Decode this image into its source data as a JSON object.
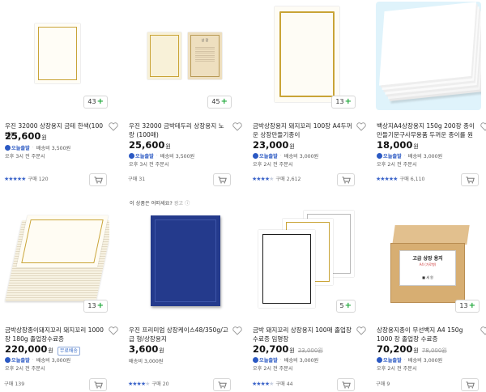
{
  "ad_notice": {
    "prefix": "이 상품은 어떠세요?",
    "label": "광고",
    "info": "ⓘ"
  },
  "products": [
    {
      "title": "우진 32000 상장용지 금테 한색(100매)",
      "price": "25,600",
      "currency": "원",
      "original_price": "",
      "today_ship": "오늘출발",
      "ship_fee": "배송비 3,500원",
      "delivery": "오후 3시 전 주문시",
      "rating": 5,
      "reviews": "구매 120",
      "option_count": "43",
      "extra_tag": ""
    },
    {
      "title": "우진 32000 금박테두리 상장용지 노랑 (100매)",
      "price": "25,600",
      "currency": "원",
      "original_price": "",
      "today_ship": "오늘출발",
      "ship_fee": "배송비 3,500원",
      "delivery": "오후 3시 전 주문시",
      "rating": 0,
      "reviews": "구매 31",
      "option_count": "45",
      "extra_tag": ""
    },
    {
      "title": "금박상장용지 돼지꼬리 100장 A4두꺼운 상장만들기종이",
      "price": "23,000",
      "currency": "원",
      "original_price": "",
      "today_ship": "오늘출발",
      "ship_fee": "배송비 3,000원",
      "delivery": "오후 2시 전 주문시",
      "rating": 4.5,
      "reviews": "구매 2,612",
      "option_count": "13",
      "extra_tag": ""
    },
    {
      "title": "백상지A4상장용지 150g 200장 종이만들기문구사무용품 두꺼운 종이를 원하...",
      "price": "18,000",
      "currency": "원",
      "original_price": "",
      "today_ship": "오늘출발",
      "ship_fee": "배송비 3,000원",
      "delivery": "오후 2시 전 주문시",
      "rating": 5,
      "reviews": "구매 6,110",
      "option_count": "",
      "extra_tag": ""
    },
    {
      "title": "금박상장종이돼지꼬리 돼지꼬리 1000장 180g 졸업장수료증",
      "price": "220,000",
      "currency": "원",
      "original_price": "",
      "today_ship": "오늘출발",
      "ship_fee": "배송비 3,000원",
      "delivery": "오후 2시 전 주문시",
      "rating": 0,
      "reviews": "구매 139",
      "option_count": "13",
      "extra_tag": "무료배송"
    },
    {
      "title": "우진 프리미엄 상장케이스48/350g/고급 형/상장용지",
      "price": "3,600",
      "currency": "원",
      "original_price": "",
      "today_ship": "",
      "ship_fee": "배송비 3,000원",
      "delivery": "",
      "rating": 4,
      "reviews": "구매 20",
      "option_count": "",
      "extra_tag": ""
    },
    {
      "title": "금박 돼지꼬리 상장용지 100매 졸업장 수료증 임명장",
      "price": "20,700",
      "currency": "원",
      "original_price": "23,000원",
      "today_ship": "오늘출발",
      "ship_fee": "배송비 3,000원",
      "delivery": "오후 2시 전 주문시",
      "rating": 4.5,
      "reviews": "구매 44",
      "option_count": "5",
      "extra_tag": ""
    },
    {
      "title": "상장용지종이 무선백지 A4 150g 1000 장 졸업장 수료증",
      "price": "70,200",
      "currency": "원",
      "original_price": "78,000원",
      "today_ship": "오늘출발",
      "ship_fee": "배송비 3,000원",
      "delivery": "오후 2시 전 주문시",
      "rating": 0,
      "reviews": "구매 9",
      "option_count": "13",
      "extra_tag": ""
    }
  ],
  "thumb_text": {
    "box_title": "고급 상장 용지",
    "box_sub": "A4 (가로형)",
    "box_brand": "■ 세 원",
    "cert_title": "상 장"
  }
}
